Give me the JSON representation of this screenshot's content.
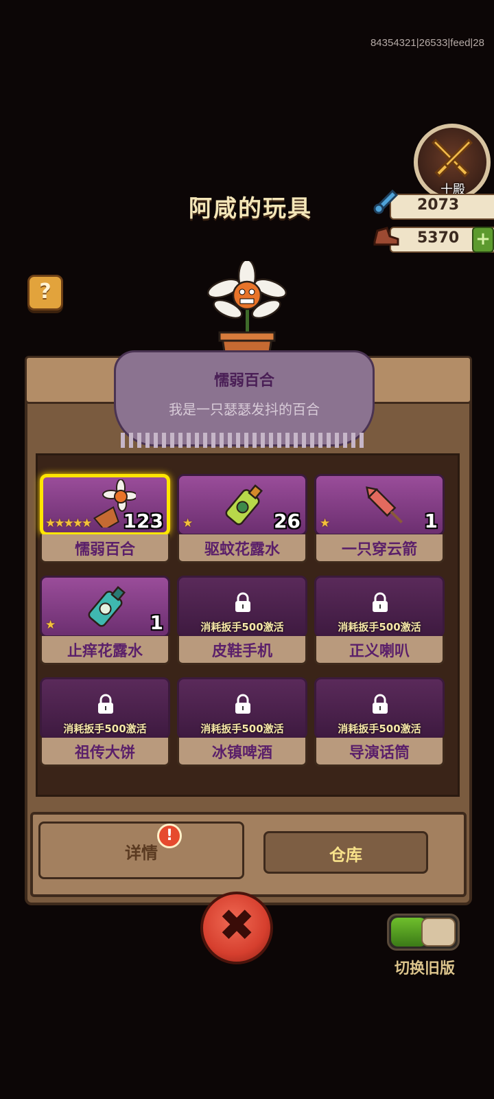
{
  "debug_id": "84354321|26533|feed|28",
  "page_title": "阿咸的玩具",
  "badge": {
    "label": "十殿",
    "icon": "crossed-swords-icon"
  },
  "currency": [
    {
      "icon": "wrench-icon",
      "value": "2073"
    },
    {
      "icon": "shoe-icon",
      "value": "5370"
    }
  ],
  "plus_label": "+",
  "help_label": "?",
  "featured": {
    "name": "懦弱百合",
    "description": "我是一只瑟瑟发抖的百合"
  },
  "items": [
    {
      "name": "懦弱百合",
      "count": "123",
      "stars": "★★★★★",
      "locked": false,
      "selected": true,
      "icon": "potted-lily-icon"
    },
    {
      "name": "驱蚊花露水",
      "count": "26",
      "stars": "★",
      "locked": false,
      "selected": false,
      "icon": "green-bottle-icon"
    },
    {
      "name": "一只穿云箭",
      "count": "1",
      "stars": "★",
      "locked": false,
      "selected": false,
      "icon": "firework-rocket-icon"
    },
    {
      "name": "止痒花露水",
      "count": "1",
      "stars": "★",
      "locked": false,
      "selected": false,
      "icon": "teal-bottle-icon"
    },
    {
      "name": "皮鞋手机",
      "lock_hint": "消耗扳手500激活",
      "locked": true,
      "icon": "shoe-phone-icon"
    },
    {
      "name": "正义喇叭",
      "lock_hint": "消耗扳手500激活",
      "locked": true,
      "icon": "megaphone-icon"
    },
    {
      "name": "祖传大饼",
      "lock_hint": "消耗扳手500激活",
      "locked": true,
      "icon": "flatbread-icon"
    },
    {
      "name": "冰镇啤酒",
      "lock_hint": "消耗扳手500激活",
      "locked": true,
      "icon": "beer-bottle-icon"
    },
    {
      "name": "导演话筒",
      "lock_hint": "消耗扳手500激活",
      "locked": true,
      "icon": "microphone-icon"
    }
  ],
  "tabs": {
    "detail": "详情",
    "warehouse": "仓库",
    "alert": "!"
  },
  "close_label": "✖",
  "toggle_label": "切换旧版",
  "colors": {
    "accent_yellow": "#ffe600",
    "card_purple": "#9a4d9a",
    "close_red": "#d63f2e",
    "toggle_green": "#5bb22a"
  }
}
